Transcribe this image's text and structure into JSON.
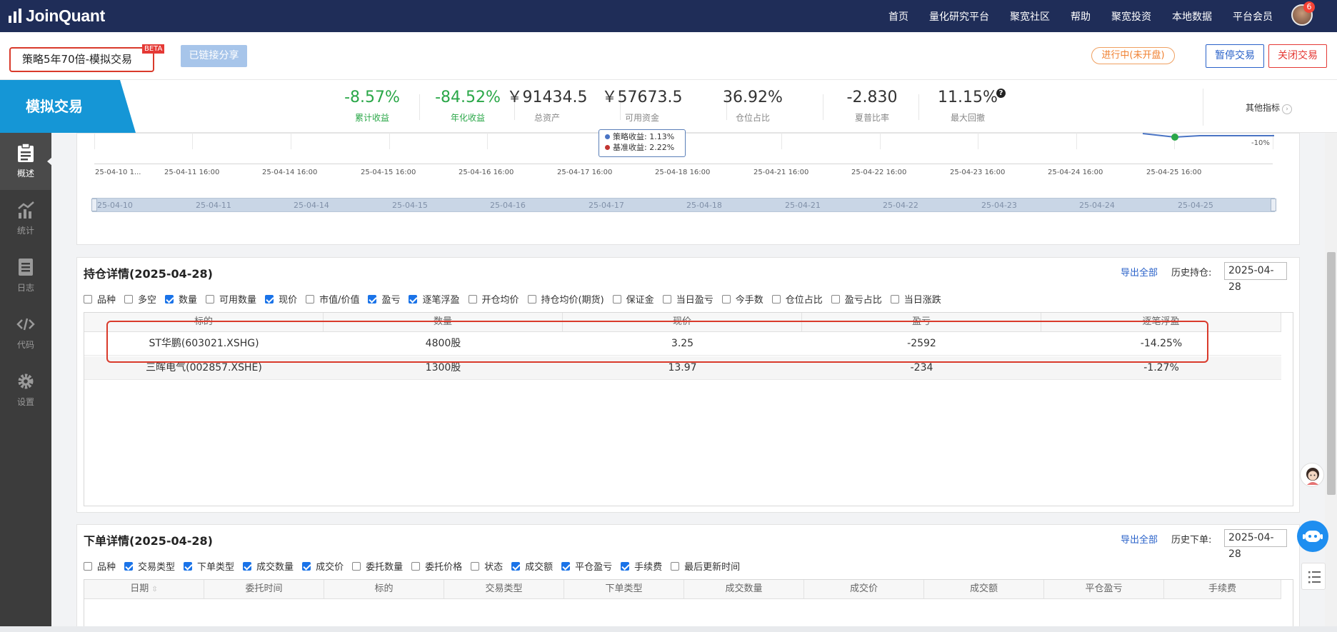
{
  "topnav": {
    "brand": "JoinQuant",
    "links": [
      "首页",
      "量化研究平台",
      "聚宽社区",
      "帮助",
      "聚宽投资",
      "本地数据",
      "平台会员"
    ],
    "notification_count": "6"
  },
  "header": {
    "strategy_name": "策略5年70倍-模拟交易",
    "beta_badge": "BETA",
    "share_button": "已链接分享",
    "status": "进行中(未开盘)",
    "pause_button": "暂停交易",
    "close_button": "关闭交易"
  },
  "metrics": {
    "section_label": "模拟交易",
    "items": [
      {
        "value": "-8.57%",
        "label": "累计收益"
      },
      {
        "value": "-84.52%",
        "label": "年化收益"
      },
      {
        "value": "￥91434.5",
        "label": "总资产"
      },
      {
        "value": "￥57673.5",
        "label": "可用资金"
      },
      {
        "value": "36.92%",
        "label": "仓位占比"
      },
      {
        "value": "-2.830",
        "label": "夏普比率"
      },
      {
        "value": "11.15%",
        "label": "最大回撤"
      }
    ],
    "help_icon": "?",
    "other_metrics": "其他指标",
    "chevron": "›"
  },
  "sidebar": {
    "items": [
      {
        "label": "概述",
        "icon": "clipboard-icon",
        "active": true
      },
      {
        "label": "统计",
        "icon": "chart-icon",
        "active": false
      },
      {
        "label": "日志",
        "icon": "log-icon",
        "active": false
      },
      {
        "label": "代码",
        "icon": "code-icon",
        "active": false
      },
      {
        "label": "设置",
        "icon": "gear-icon",
        "active": false
      }
    ]
  },
  "chart": {
    "tooltip": {
      "strategy_label": "策略收益: 1.13%",
      "benchmark_label": "基准收益: 2.22%"
    },
    "y_label": "-10%",
    "x_ticks": [
      "25-04-10 1...",
      "25-04-11 16:00",
      "25-04-14 16:00",
      "25-04-15 16:00",
      "25-04-16 16:00",
      "25-04-17 16:00",
      "25-04-18 16:00",
      "25-04-21 16:00",
      "25-04-22 16:00",
      "25-04-23 16:00",
      "25-04-24 16:00",
      "25-04-25 16:00"
    ],
    "slider_labels": [
      "25-04-10",
      "25-04-11",
      "25-04-14",
      "25-04-15",
      "25-04-16",
      "25-04-17",
      "25-04-18",
      "25-04-21",
      "25-04-22",
      "25-04-23",
      "25-04-24",
      "25-04-25"
    ],
    "colors": {
      "strategy": "#4a74c4",
      "benchmark": "#c23531",
      "marker": "#2aa748"
    }
  },
  "positions": {
    "title": "持仓详情(2025-04-28)",
    "export": "导出全部",
    "history_label": "历史持仓:",
    "history_date": "2025-04-28",
    "checkboxes": [
      {
        "label": "品种",
        "checked": false
      },
      {
        "label": "多空",
        "checked": false
      },
      {
        "label": "数量",
        "checked": true
      },
      {
        "label": "可用数量",
        "checked": false
      },
      {
        "label": "现价",
        "checked": true
      },
      {
        "label": "市值/价值",
        "checked": false
      },
      {
        "label": "盈亏",
        "checked": true
      },
      {
        "label": "逐笔浮盈",
        "checked": true
      },
      {
        "label": "开仓均价",
        "checked": false
      },
      {
        "label": "持仓均价(期货)",
        "checked": false
      },
      {
        "label": "保证金",
        "checked": false
      },
      {
        "label": "当日盈亏",
        "checked": false
      },
      {
        "label": "今手数",
        "checked": false
      },
      {
        "label": "仓位占比",
        "checked": false
      },
      {
        "label": "盈亏占比",
        "checked": false
      },
      {
        "label": "当日涨跌",
        "checked": false
      }
    ],
    "columns": [
      "标的",
      "数量",
      "现价",
      "盈亏",
      "逐笔浮盈"
    ],
    "rows": [
      [
        "ST华鹏(603021.XSHG)",
        "4800股",
        "3.25",
        "-2592",
        "-14.25%"
      ],
      [
        "三晖电气(002857.XSHE)",
        "1300股",
        "13.97",
        "-234",
        "-1.27%"
      ]
    ]
  },
  "orders": {
    "title": "下单详情(2025-04-28)",
    "export": "导出全部",
    "history_label": "历史下单:",
    "history_date": "2025-04-28",
    "checkboxes": [
      {
        "label": "品种",
        "checked": false
      },
      {
        "label": "交易类型",
        "checked": true
      },
      {
        "label": "下单类型",
        "checked": true
      },
      {
        "label": "成交数量",
        "checked": true
      },
      {
        "label": "成交价",
        "checked": true
      },
      {
        "label": "委托数量",
        "checked": false
      },
      {
        "label": "委托价格",
        "checked": false
      },
      {
        "label": "状态",
        "checked": false
      },
      {
        "label": "成交额",
        "checked": true
      },
      {
        "label": "平仓盈亏",
        "checked": true
      },
      {
        "label": "手续费",
        "checked": true
      },
      {
        "label": "最后更新时间",
        "checked": false
      }
    ],
    "columns": [
      "日期",
      "委托时间",
      "标的",
      "交易类型",
      "下单类型",
      "成交数量",
      "成交价",
      "成交额",
      "平仓盈亏",
      "手续费"
    ],
    "sort_icon": "⇳"
  }
}
